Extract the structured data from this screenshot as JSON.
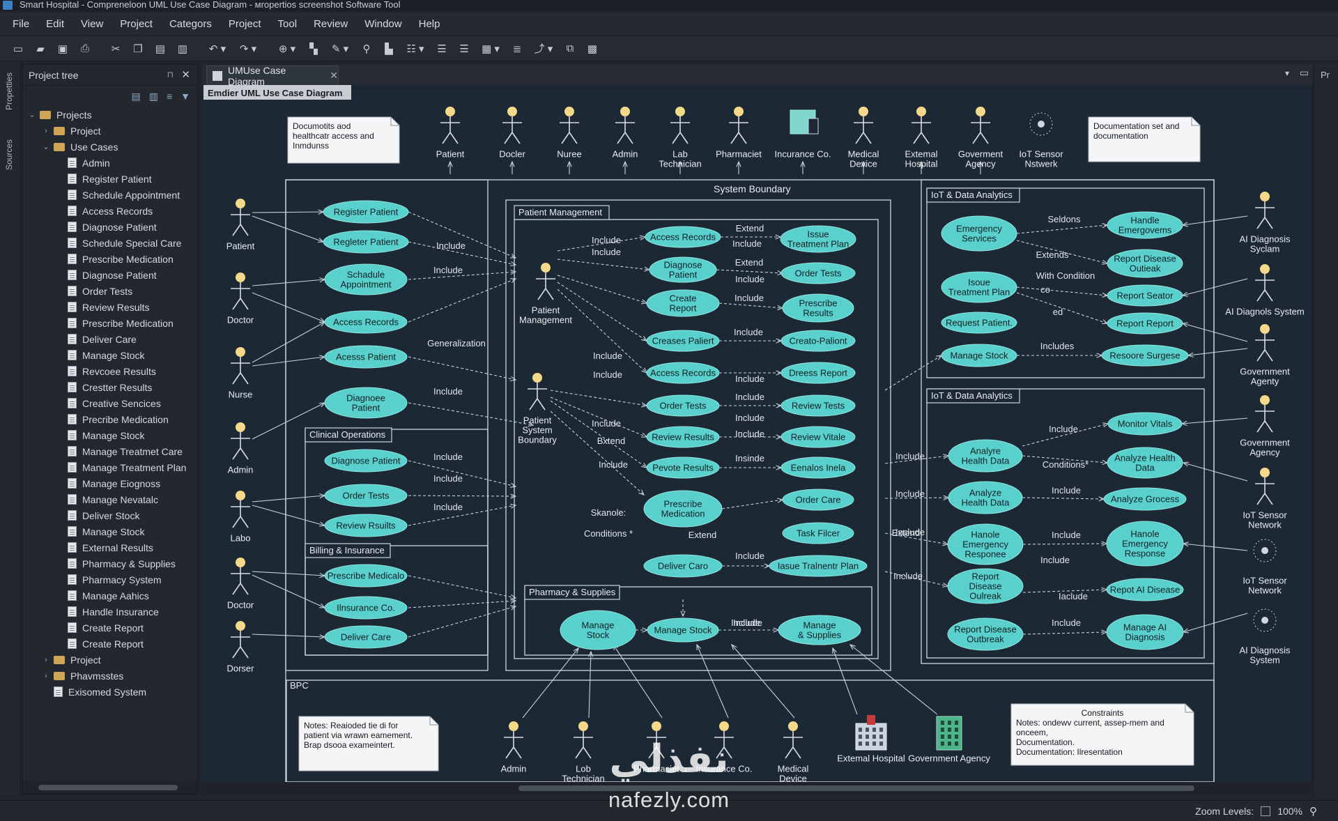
{
  "window": {
    "title": "Smart Hospital - Compreneloon UML Use Case Diagram - ᴍropertios screenshot Software Tool"
  },
  "menu": [
    "File",
    "Edit",
    "View",
    "Project",
    "Categors",
    "Project",
    "Tool",
    "Review",
    "Window",
    "Help"
  ],
  "side_tabs": {
    "left": [
      "Propetties",
      "Sources"
    ],
    "right": "Pr"
  },
  "project_tree": {
    "title": "Project tree",
    "items": [
      {
        "label": "Projects",
        "type": "folder",
        "level": 0,
        "toggle": "⌄"
      },
      {
        "label": "Project",
        "type": "folder",
        "level": 1,
        "toggle": "›"
      },
      {
        "label": "Use Cases",
        "type": "folder",
        "level": 1,
        "toggle": "⌄"
      },
      {
        "label": "Admin",
        "type": "doc",
        "level": 2
      },
      {
        "label": "Register Patient",
        "type": "doc",
        "level": 2
      },
      {
        "label": "Schedule Appointment",
        "type": "doc",
        "level": 2
      },
      {
        "label": "Access Records",
        "type": "doc",
        "level": 2
      },
      {
        "label": "Diagnose Patient",
        "type": "doc",
        "level": 2
      },
      {
        "label": "Schedule Special Care",
        "type": "doc",
        "level": 2
      },
      {
        "label": "Prescribe Medication",
        "type": "doc",
        "level": 2
      },
      {
        "label": "Diagnose Patient",
        "type": "doc",
        "level": 2
      },
      {
        "label": "Order Tests",
        "type": "doc",
        "level": 2
      },
      {
        "label": "Review Results",
        "type": "doc",
        "level": 2
      },
      {
        "label": "Prescribe Medication",
        "type": "doc",
        "level": 2
      },
      {
        "label": "Deliver Care",
        "type": "doc",
        "level": 2
      },
      {
        "label": "Manage Stock",
        "type": "doc",
        "level": 2
      },
      {
        "label": "Revcoee Results",
        "type": "doc",
        "level": 2
      },
      {
        "label": "Crestter Results",
        "type": "doc",
        "level": 2
      },
      {
        "label": "Creative Sencices",
        "type": "doc",
        "level": 2
      },
      {
        "label": "Precribe Medication",
        "type": "doc",
        "level": 2
      },
      {
        "label": "Manage Stock",
        "type": "doc",
        "level": 2
      },
      {
        "label": "Manage Treatmet Care",
        "type": "doc",
        "level": 2
      },
      {
        "label": "Manage Treatment Plan",
        "type": "doc",
        "level": 2
      },
      {
        "label": "Manage Eiognoss",
        "type": "doc",
        "level": 2
      },
      {
        "label": "Manage Nevatalc",
        "type": "doc",
        "level": 2
      },
      {
        "label": "Deliver Stock",
        "type": "doc",
        "level": 2
      },
      {
        "label": "Manage Stock",
        "type": "doc",
        "level": 2
      },
      {
        "label": "External Results",
        "type": "doc",
        "level": 2
      },
      {
        "label": "Pharmacy & Supplies",
        "type": "doc",
        "level": 2
      },
      {
        "label": "Pharmacy System",
        "type": "doc",
        "level": 2
      },
      {
        "label": "Manage Aahics",
        "type": "doc",
        "level": 2
      },
      {
        "label": "Handle Insurance",
        "type": "doc",
        "level": 2
      },
      {
        "label": "Create Report",
        "type": "doc",
        "level": 2
      },
      {
        "label": "Create Report",
        "type": "doc",
        "level": 2
      },
      {
        "label": "Project",
        "type": "folder",
        "level": 1,
        "toggle": "›"
      },
      {
        "label": "Phavmsstes",
        "type": "folder",
        "level": 1,
        "toggle": "›"
      },
      {
        "label": "Exisomed System",
        "type": "doc",
        "level": 1
      }
    ]
  },
  "tab": {
    "label": "UMUse Case Diagram"
  },
  "diagram": {
    "title": "Emdier UML Use Case Diagram",
    "ellipse_fill": "#5ad0cc",
    "notes": [
      {
        "lines": [
          "Documotits aod",
          "healthcatr access and",
          "Inmdunss"
        ]
      },
      {
        "lines": [
          "Documentation set and",
          "documentation"
        ]
      },
      {
        "lines": [
          "Notes: Reaioded tie di for",
          "patient via wrawn eamement.",
          "Brap dsooa exameintert."
        ]
      },
      {
        "lines": [
          "Constraints",
          "Notes: ondewv current, assep-mem and",
          "onceem,",
          "Documentation.",
          "Documentation: Ilresentation"
        ]
      }
    ],
    "actors_top": [
      "Patient",
      "Docler",
      "Nuree",
      "Admin",
      "Lab|Technician",
      "Pharmaciet",
      "Incurance Co.",
      "Medical|Device",
      "Extemal|Hospital",
      "Goverment|Agency",
      "IoT Sensor|Nstwerk"
    ],
    "actors_left": [
      "Patient",
      "Doctor",
      "Nurse",
      "Admin",
      "Labo",
      "Doctor",
      "Dorser"
    ],
    "actors_right": [
      "AI Diagnosis|Syclam",
      "AI Diagnols System",
      "Government|Agenty",
      "Government|Agency",
      "IoT Sensor|Network",
      "IoT Sensor|Network",
      "AI Diagnosis|System"
    ],
    "actors_bottom": [
      "Admin",
      "Lob|Technician",
      "Pharmaciet",
      "Insurance Co.",
      "Medical|Device",
      "Extemal Hospital",
      "Government Agency"
    ],
    "actors_center": [
      "Patient|Management",
      "Patient|System|Boundary"
    ],
    "packages": [
      "System Boundary",
      "Patient Management",
      "IoT & Data Analytics",
      "IoT & Data Analytics",
      "Clinical Operations",
      "Billing & Insurance",
      "Pharmacy & Supplies",
      "BPC"
    ],
    "usecases_left": [
      "Register Patient",
      "Regleter Patient",
      "Schadule|Appointment",
      "Access Records",
      "Acesss Patient",
      "Diagnoee|Patient",
      "Diagnose Patient",
      "Order Tests",
      "Review Rsuilts",
      "Prescribe Medicalo",
      "Ilnsurance Co.",
      "Deliver Care"
    ],
    "usecases_center": [
      "Access Records",
      "Diagnose|Patient",
      "Create|Report",
      "Creases Paliert",
      "Access Records",
      "Order Tests",
      "Review Results",
      "Pevote Results",
      "Prescribe|Medication",
      "Deliver Caro",
      "Issue|Treatment Plan",
      "Order Tests",
      "Prescribe|Results",
      "Creato-Paliont",
      "Dreess Report",
      "Review Tests",
      "Review Vitale",
      "Eenalos Inela",
      "Order Care",
      "Task Filcer",
      "Iasue Tralnentr Plan"
    ],
    "usecases_pharmacy": [
      "Manage|Stock",
      "Manage Stock",
      "Manage|& Supplies"
    ],
    "usecases_iot_top": [
      "Emergency|Services",
      "Isoue|Treatment Plan",
      "Request Patient.",
      "Manage Stock",
      "Handle|Emergovems",
      "Report Disease|Outieak",
      "Report Seator",
      "Report Report",
      "Resoore Surgese"
    ],
    "usecases_iot_bottom": [
      "Analyre|Health Data",
      "Analyze|Health Data",
      "Hanole|Emergency|Responee",
      "Report|Disease|Oulreak",
      "Report Disease|Outbreak",
      "Monitor Vitals",
      "Analyze Health|Data",
      "Analyze Grocess",
      "Hanole|Emergency|Response",
      "Repot AI Disease",
      "Manage AI|Diagnosis"
    ],
    "edge_labels": [
      "Include",
      "Include",
      "Generalization",
      "Include",
      "Include",
      "Include",
      "Include",
      "Include",
      "Include",
      "Extend",
      "Include",
      "Extend",
      "Include",
      "Include",
      "Include",
      "Include",
      "Include",
      "Include",
      "Include",
      "Include",
      "Include",
      "Include",
      "Bxtend",
      "Include",
      "Insinde",
      "Extend",
      "Skanole:",
      "Conditions *",
      "Include",
      "Include",
      "Seldons",
      "Extends",
      "With Condition",
      "Includes",
      "Include",
      "Conditions*",
      "Include",
      "Include",
      "Include",
      "Iaclude",
      "Include",
      "Include",
      "Include",
      "Include",
      "Include",
      "Extend",
      "Include",
      "co",
      "ed"
    ]
  },
  "status": {
    "zoom_label": "Zoom Levels:",
    "zoom_value": "100%"
  },
  "watermark": {
    "arabic": "نفذلي",
    "latin": "nafezly.com"
  }
}
